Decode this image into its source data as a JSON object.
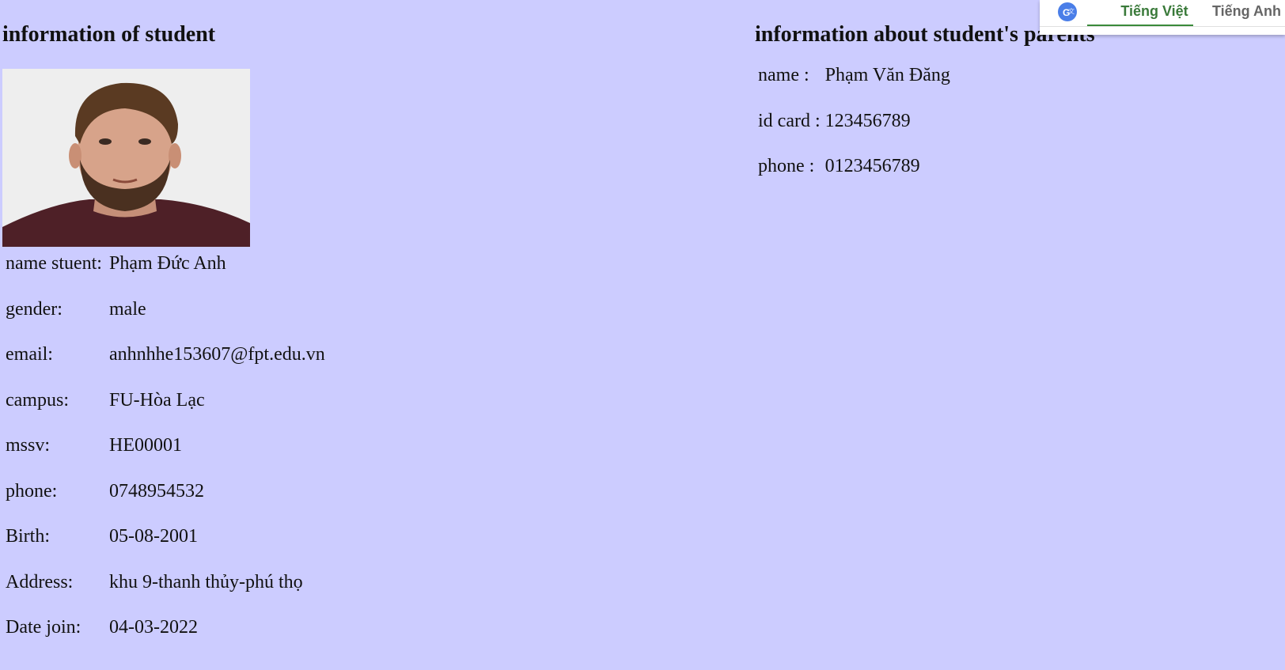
{
  "student": {
    "heading": "information of student",
    "fields": [
      {
        "label": "name stuent:",
        "value": "Phạm Đức Anh"
      },
      {
        "label": "gender:",
        "value": "male"
      },
      {
        "label": "email:",
        "value": "anhnhhe153607@fpt.edu.vn"
      },
      {
        "label": "campus:",
        "value": "FU-Hòa Lạc"
      },
      {
        "label": "mssv:",
        "value": "HE00001"
      },
      {
        "label": "phone:",
        "value": "0748954532"
      },
      {
        "label": "Birth:",
        "value": "05-08-2001"
      },
      {
        "label": "Address:",
        "value": "khu 9-thanh thủy-phú thọ"
      },
      {
        "label": "Date join:",
        "value": "04-03-2022"
      }
    ]
  },
  "parents": {
    "heading": "information about student's parents",
    "fields": [
      {
        "label": "name :",
        "value": "Phạm Văn Đăng"
      },
      {
        "label": "id card :",
        "value": "123456789"
      },
      {
        "label": "phone :",
        "value": "0123456789"
      }
    ]
  },
  "translate_bar": {
    "icon": "google-translate-icon",
    "tab_active": "Tiếng Việt",
    "tab_inactive": "Tiếng Anh",
    "accent_color": "#3a8a3a"
  },
  "colors": {
    "background": "#ccccff"
  }
}
